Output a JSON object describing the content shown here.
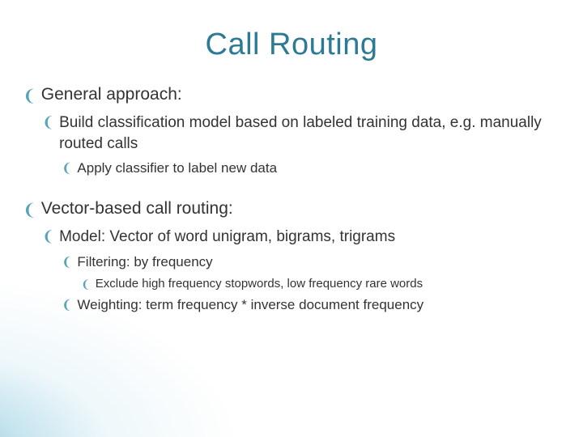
{
  "title": "Call Routing",
  "bulletGlyph": "❨",
  "lines": {
    "a": "General approach:",
    "a1": "Build classification model based on labeled training data, e.g. manually routed calls",
    "a2": "Apply classifier to label new data",
    "b": "Vector-based call routing:",
    "b1": "Model: Vector of word unigram, bigrams, trigrams",
    "b11": "Filtering: by frequency",
    "b111": "Exclude high frequency stopwords, low frequency rare words",
    "b12": "Weighting: term frequency * inverse document frequency"
  }
}
